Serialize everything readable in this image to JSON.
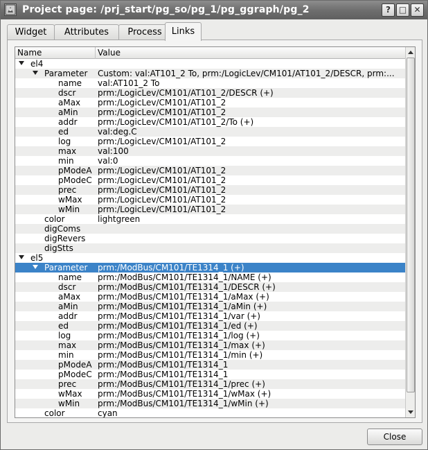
{
  "window": {
    "title": "Project page: /prj_start/pg_so/pg_1/pg_ggraph/pg_2",
    "help_label": "?",
    "maximize_label": "□",
    "close_label": "✕"
  },
  "tabs": [
    {
      "label": "Widget"
    },
    {
      "label": "Attributes"
    },
    {
      "label": "Process"
    },
    {
      "label": "Links",
      "active": true
    }
  ],
  "tree": {
    "columns": {
      "name": "Name",
      "value": "Value"
    },
    "rows": [
      {
        "level": 0,
        "expanded": true,
        "name": "el4",
        "value": ""
      },
      {
        "level": 1,
        "expanded": true,
        "name": "Parameter",
        "value": "Custom: val:AT101_2 To, prm:/LogicLev/CM101/AT101_2/DESCR, prm:..."
      },
      {
        "level": 2,
        "name": "name",
        "value": "val:AT101_2 To"
      },
      {
        "level": 2,
        "name": "dscr",
        "value": "prm:/LogicLev/CM101/AT101_2/DESCR (+)"
      },
      {
        "level": 2,
        "name": "aMax",
        "value": "prm:/LogicLev/CM101/AT101_2"
      },
      {
        "level": 2,
        "name": "aMin",
        "value": "prm:/LogicLev/CM101/AT101_2"
      },
      {
        "level": 2,
        "name": "addr",
        "value": "prm:/LogicLev/CM101/AT101_2/To (+)"
      },
      {
        "level": 2,
        "name": "ed",
        "value": "val:deg.C"
      },
      {
        "level": 2,
        "name": "log",
        "value": "prm:/LogicLev/CM101/AT101_2"
      },
      {
        "level": 2,
        "name": "max",
        "value": "val:100"
      },
      {
        "level": 2,
        "name": "min",
        "value": "val:0"
      },
      {
        "level": 2,
        "name": "pModeA",
        "value": "prm:/LogicLev/CM101/AT101_2"
      },
      {
        "level": 2,
        "name": "pModeC",
        "value": "prm:/LogicLev/CM101/AT101_2"
      },
      {
        "level": 2,
        "name": "prec",
        "value": "prm:/LogicLev/CM101/AT101_2"
      },
      {
        "level": 2,
        "name": "wMax",
        "value": "prm:/LogicLev/CM101/AT101_2"
      },
      {
        "level": 2,
        "name": "wMin",
        "value": "prm:/LogicLev/CM101/AT101_2"
      },
      {
        "level": 1,
        "name": "color",
        "value": "lightgreen"
      },
      {
        "level": 1,
        "name": "digComs",
        "value": ""
      },
      {
        "level": 1,
        "name": "digRevers",
        "value": ""
      },
      {
        "level": 1,
        "name": "digStts",
        "value": ""
      },
      {
        "level": 0,
        "expanded": true,
        "name": "el5",
        "value": ""
      },
      {
        "level": 1,
        "expanded": true,
        "selected": true,
        "name": "Parameter",
        "value": "prm:/ModBus/CM101/TE1314_1 (+)"
      },
      {
        "level": 2,
        "name": "name",
        "value": "prm:/ModBus/CM101/TE1314_1/NAME (+)"
      },
      {
        "level": 2,
        "name": "dscr",
        "value": "prm:/ModBus/CM101/TE1314_1/DESCR (+)"
      },
      {
        "level": 2,
        "name": "aMax",
        "value": "prm:/ModBus/CM101/TE1314_1/aMax (+)"
      },
      {
        "level": 2,
        "name": "aMin",
        "value": "prm:/ModBus/CM101/TE1314_1/aMin (+)"
      },
      {
        "level": 2,
        "name": "addr",
        "value": "prm:/ModBus/CM101/TE1314_1/var (+)"
      },
      {
        "level": 2,
        "name": "ed",
        "value": "prm:/ModBus/CM101/TE1314_1/ed (+)"
      },
      {
        "level": 2,
        "name": "log",
        "value": "prm:/ModBus/CM101/TE1314_1/log (+)"
      },
      {
        "level": 2,
        "name": "max",
        "value": "prm:/ModBus/CM101/TE1314_1/max (+)"
      },
      {
        "level": 2,
        "name": "min",
        "value": "prm:/ModBus/CM101/TE1314_1/min (+)"
      },
      {
        "level": 2,
        "name": "pModeA",
        "value": "prm:/ModBus/CM101/TE1314_1"
      },
      {
        "level": 2,
        "name": "pModeC",
        "value": "prm:/ModBus/CM101/TE1314_1"
      },
      {
        "level": 2,
        "name": "prec",
        "value": "prm:/ModBus/CM101/TE1314_1/prec (+)"
      },
      {
        "level": 2,
        "name": "wMax",
        "value": "prm:/ModBus/CM101/TE1314_1/wMax (+)"
      },
      {
        "level": 2,
        "name": "wMin",
        "value": "prm:/ModBus/CM101/TE1314_1/wMin (+)"
      },
      {
        "level": 1,
        "name": "color",
        "value": "cyan"
      }
    ]
  },
  "footer": {
    "close_label": "Close"
  },
  "colors": {
    "selection": "#3b83c8",
    "titlebar": "#6f6f6f"
  }
}
